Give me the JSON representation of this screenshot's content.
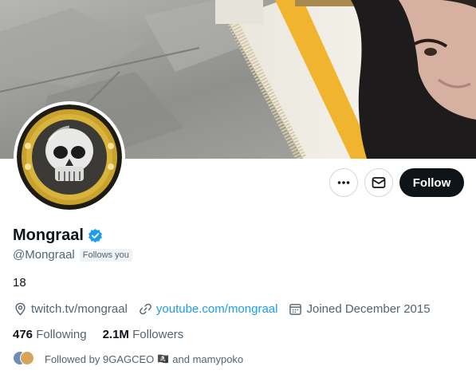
{
  "profile": {
    "display_name": "Mongraal",
    "handle": "@Mongraal",
    "follows_you_badge": "Follows you",
    "bio": "18",
    "verified": true,
    "verified_color": "#1d9bf0"
  },
  "actions": {
    "more_icon": "more-horizontal-icon",
    "message_icon": "envelope-icon",
    "follow_label": "Follow"
  },
  "meta": {
    "location": "twitch.tv/mongraal",
    "website": "youtube.com/mongraal",
    "joined": "Joined December 2015"
  },
  "stats": {
    "following_count": "476",
    "following_label": "Following",
    "followers_count": "2.1M",
    "followers_label": "Followers"
  },
  "followed_by": {
    "prefix": "Followed by",
    "first": "9GAGCEO",
    "emoji": "🏴‍☠️",
    "connector": "and",
    "second": "mamypoko"
  },
  "colors": {
    "accent": "#1d9bf0",
    "text_primary": "#0f1419",
    "text_secondary": "#536471",
    "follow_button": "#0f1419"
  }
}
